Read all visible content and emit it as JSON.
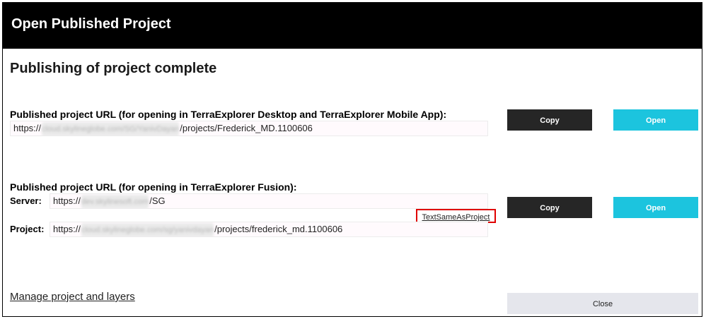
{
  "window": {
    "title": "Open Published Project"
  },
  "heading": "Publishing of project complete",
  "desktop_section": {
    "label": "Published project URL (for opening in TerraExplorer Desktop and TerraExplorer Mobile App):",
    "url_prefix": "https://",
    "url_blurred": "cloud.skylineglobe.com/SG/YanivDayan",
    "url_suffix": "/projects/Frederick_MD.1100606",
    "copy_label": "Copy",
    "open_label": "Open"
  },
  "fusion_section": {
    "label": "Published project URL (for opening in TerraExplorer Fusion):",
    "server_label": "Server:",
    "server_prefix": "https://",
    "server_blurred": "dev.skylinesoft.com",
    "server_suffix": "/SG",
    "project_label": "Project:",
    "project_prefix": "https://",
    "project_blurred": "cloud.skylineglobe.com/sg/yanivdayan",
    "project_suffix": "/projects/frederick_md.1100606",
    "text_same_link": "TextSameAsProject",
    "copy_label": "Copy",
    "open_label": "Open"
  },
  "footer": {
    "manage_link": "Manage project and layers",
    "close_label": "Close"
  },
  "colors": {
    "titlebar": "#000000",
    "copy_button": "#262626",
    "open_button": "#1cc4de",
    "close_button": "#e5e6ec",
    "highlight_border": "#e00000"
  }
}
